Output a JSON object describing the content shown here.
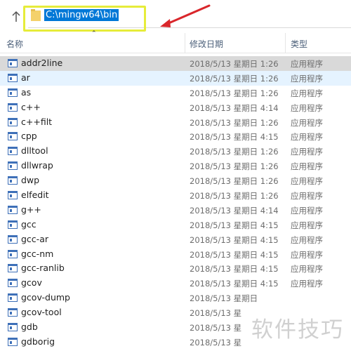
{
  "address_bar": {
    "path": "C:\\mingw64\\bin"
  },
  "header": {
    "name_col": "名称",
    "date_col": "修改日期",
    "type_col": "类型"
  },
  "files": [
    {
      "name": "addr2line",
      "date": "2018/5/13 星期日 1:26",
      "type": "应用程序"
    },
    {
      "name": "ar",
      "date": "2018/5/13 星期日 1:26",
      "type": "应用程序"
    },
    {
      "name": "as",
      "date": "2018/5/13 星期日 1:26",
      "type": "应用程序"
    },
    {
      "name": "c++",
      "date": "2018/5/13 星期日 4:14",
      "type": "应用程序"
    },
    {
      "name": "c++filt",
      "date": "2018/5/13 星期日 1:26",
      "type": "应用程序"
    },
    {
      "name": "cpp",
      "date": "2018/5/13 星期日 4:15",
      "type": "应用程序"
    },
    {
      "name": "dlltool",
      "date": "2018/5/13 星期日 1:26",
      "type": "应用程序"
    },
    {
      "name": "dllwrap",
      "date": "2018/5/13 星期日 1:26",
      "type": "应用程序"
    },
    {
      "name": "dwp",
      "date": "2018/5/13 星期日 1:26",
      "type": "应用程序"
    },
    {
      "name": "elfedit",
      "date": "2018/5/13 星期日 1:26",
      "type": "应用程序"
    },
    {
      "name": "g++",
      "date": "2018/5/13 星期日 4:14",
      "type": "应用程序"
    },
    {
      "name": "gcc",
      "date": "2018/5/13 星期日 4:15",
      "type": "应用程序"
    },
    {
      "name": "gcc-ar",
      "date": "2018/5/13 星期日 4:15",
      "type": "应用程序"
    },
    {
      "name": "gcc-nm",
      "date": "2018/5/13 星期日 4:15",
      "type": "应用程序"
    },
    {
      "name": "gcc-ranlib",
      "date": "2018/5/13 星期日 4:15",
      "type": "应用程序"
    },
    {
      "name": "gcov",
      "date": "2018/5/13 星期日 4:15",
      "type": "应用程序"
    },
    {
      "name": "gcov-dump",
      "date": "2018/5/13 星期日",
      "type": ""
    },
    {
      "name": "gcov-tool",
      "date": "2018/5/13 星",
      "type": ""
    },
    {
      "name": "gdb",
      "date": "2018/5/13 星",
      "type": ""
    },
    {
      "name": "gdborig",
      "date": "2018/5/13 星",
      "type": ""
    }
  ],
  "watermark": "软件技巧",
  "colors": {
    "highlight_box": "#e6ec3a",
    "selection_blue": "#0078d7",
    "arrow_red": "#d9262b",
    "selected_row": "#d9d9d9",
    "hover_row": "#e5f3ff"
  }
}
